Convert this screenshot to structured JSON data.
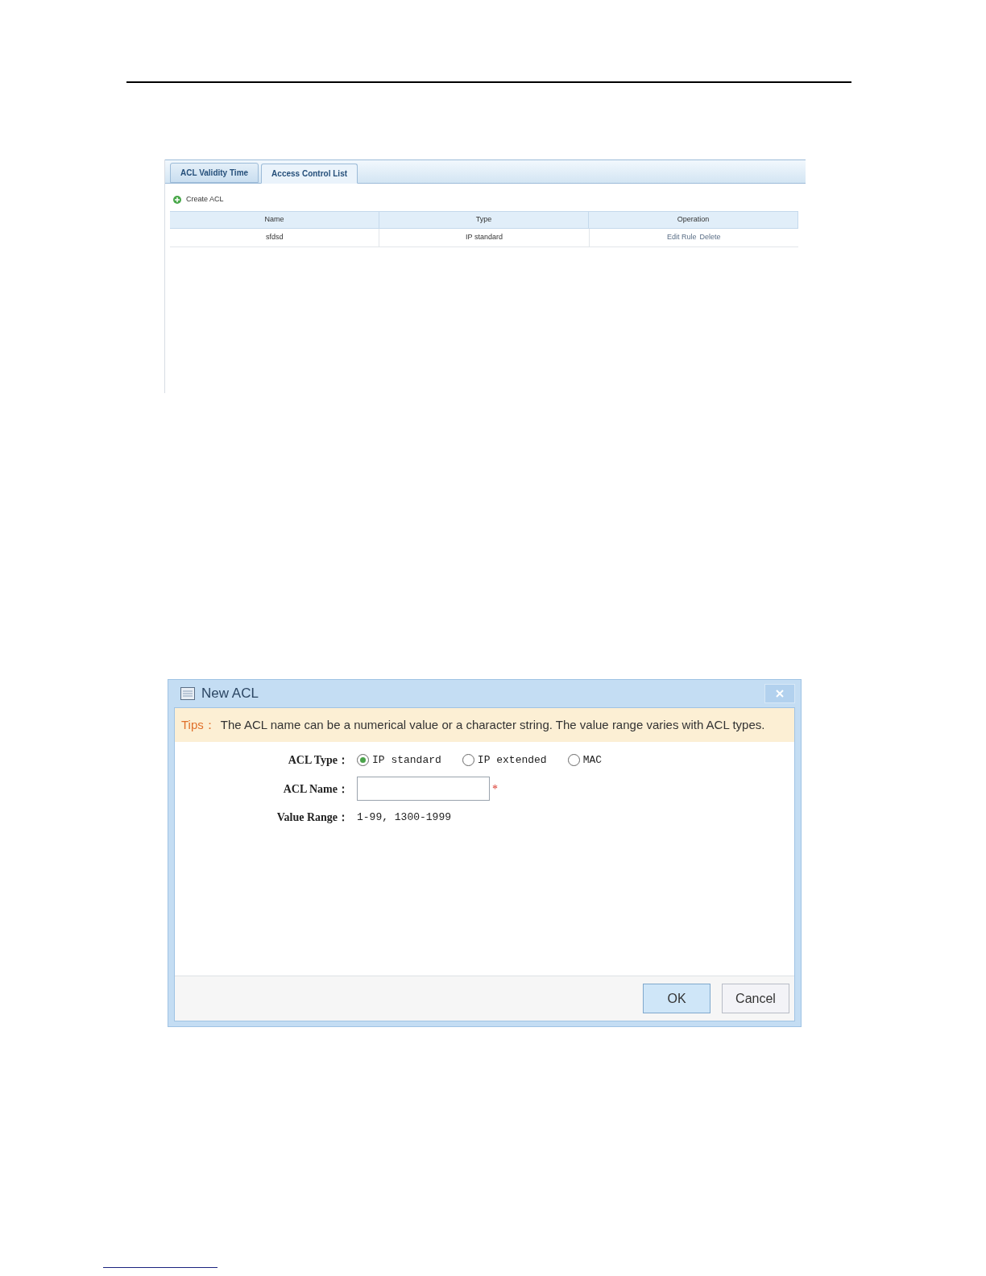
{
  "acl_list": {
    "tabs": [
      {
        "label": "ACL Validity Time",
        "selected": false
      },
      {
        "label": "Access Control List",
        "selected": true
      }
    ],
    "create_button": "Create ACL",
    "table": {
      "columns": [
        "Name",
        "Type",
        "Operation"
      ],
      "rows": [
        {
          "name": "sfdsd",
          "type": "IP standard",
          "operations": [
            "Edit Rule",
            "Delete"
          ]
        }
      ]
    }
  },
  "dialog": {
    "title": "New ACL",
    "tips_label": "Tips：",
    "tips_text": "The ACL name can be a numerical value or a character string. The value range varies with ACL types.",
    "acl_type": {
      "label": "ACL Type：",
      "options": [
        {
          "label": "IP standard",
          "selected": true
        },
        {
          "label": "IP extended",
          "selected": false
        },
        {
          "label": "MAC",
          "selected": false
        }
      ]
    },
    "acl_name": {
      "label": "ACL Name：",
      "required_mark": "*"
    },
    "value_range": {
      "label": "Value Range：",
      "value": "1-99, 1300-1999"
    },
    "buttons": [
      {
        "label": "OK",
        "kind": "primary"
      },
      {
        "label": "Cancel",
        "kind": "secondary"
      }
    ]
  }
}
